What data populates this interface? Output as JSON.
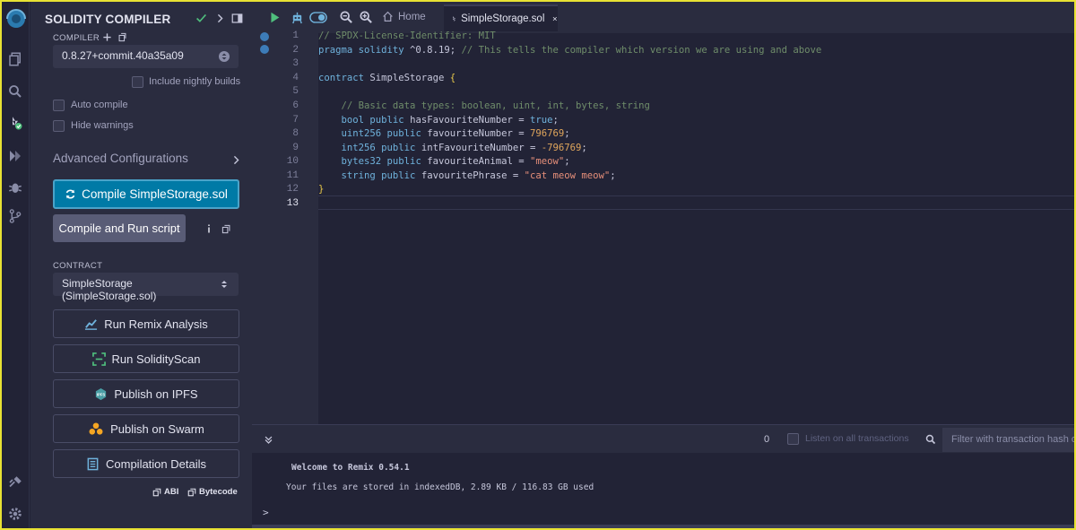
{
  "panel": {
    "title": "SOLIDITY COMPILER",
    "compiler_label": "COMPILER",
    "compiler_version": "0.8.27+commit.40a35a09",
    "nightly_label": "Include nightly builds",
    "auto_compile_label": "Auto compile",
    "hide_warnings_label": "Hide warnings",
    "advanced_label": "Advanced Configurations",
    "compile_button": "Compile SimpleStorage.sol",
    "run_script_button": "Compile and Run script",
    "contract_label": "CONTRACT",
    "contract_value": "SimpleStorage (SimpleStorage.sol)",
    "remix_analysis": "Run Remix Analysis",
    "solidity_scan": "Run SolidityScan",
    "publish_ipfs": "Publish on IPFS",
    "publish_swarm": "Publish on Swarm",
    "compilation_details": "Compilation Details",
    "abi_label": "ABI",
    "bytecode_label": "Bytecode",
    "ipfs_badge": "IPFS"
  },
  "tabs": {
    "home": "Home",
    "active_file": "SimpleStorage.sol"
  },
  "editor": {
    "line_numbers": [
      "1",
      "2",
      "3",
      "4",
      "5",
      "6",
      "7",
      "8",
      "9",
      "10",
      "11",
      "12",
      "13"
    ],
    "l1": "// SPDX-License-Identifier: MIT",
    "l2_kw": "pragma solidity",
    "l2_ver": " ^0.8.19;",
    "l2_com": " // This tells the compiler which version we are using and above",
    "l4_kw": "contract",
    "l4_id": " SimpleStorage ",
    "l4_brace": "{",
    "l6": "    // Basic data types: boolean, uint, int, bytes, string",
    "l7_type": "    bool",
    "l7_mod": " public",
    "l7_name": " hasFavouriteNumber = ",
    "l7_val": "true",
    "l8_type": "    uint256",
    "l8_mod": " public",
    "l8_name": " favouriteNumber = ",
    "l8_val": "796769",
    "l9_type": "    int256",
    "l9_mod": " public",
    "l9_name": " intFavouriteNumber = ",
    "l9_val": "-796769",
    "l10_type": "    bytes32",
    "l10_mod": " public",
    "l10_name": " favouriteAnimal = ",
    "l10_val": "\"meow\"",
    "l11_type": "    string",
    "l11_mod": " public",
    "l11_name": " favouritePhrase = ",
    "l11_val": "\"cat meow meow\"",
    "semicolon": ";",
    "l12": "}"
  },
  "terminal": {
    "count": "0",
    "listen_label": "Listen on all transactions",
    "filter_placeholder": "Filter with transaction hash or address",
    "welcome": "Welcome to Remix 0.54.1",
    "storage": "Your files are stored in indexedDB, 2.89 KB / 116.83 GB used",
    "prompt": ">"
  },
  "colors": {
    "accent": "#007aa6",
    "highlight_border": "#e8e233",
    "success": "#4fbf7d"
  },
  "icons": {
    "rail": [
      "remix-logo-icon",
      "file-explorer-icon",
      "search-icon",
      "solidity-compiler-icon",
      "deploy-icon",
      "debugger-icon",
      "git-icon",
      "plugin-icon",
      "settings-icon"
    ],
    "topbar": [
      "run-icon",
      "robot-icon",
      "toggle-icon",
      "zoom-out-icon",
      "zoom-in-icon",
      "home-icon",
      "file-icon",
      "close-icon"
    ]
  }
}
